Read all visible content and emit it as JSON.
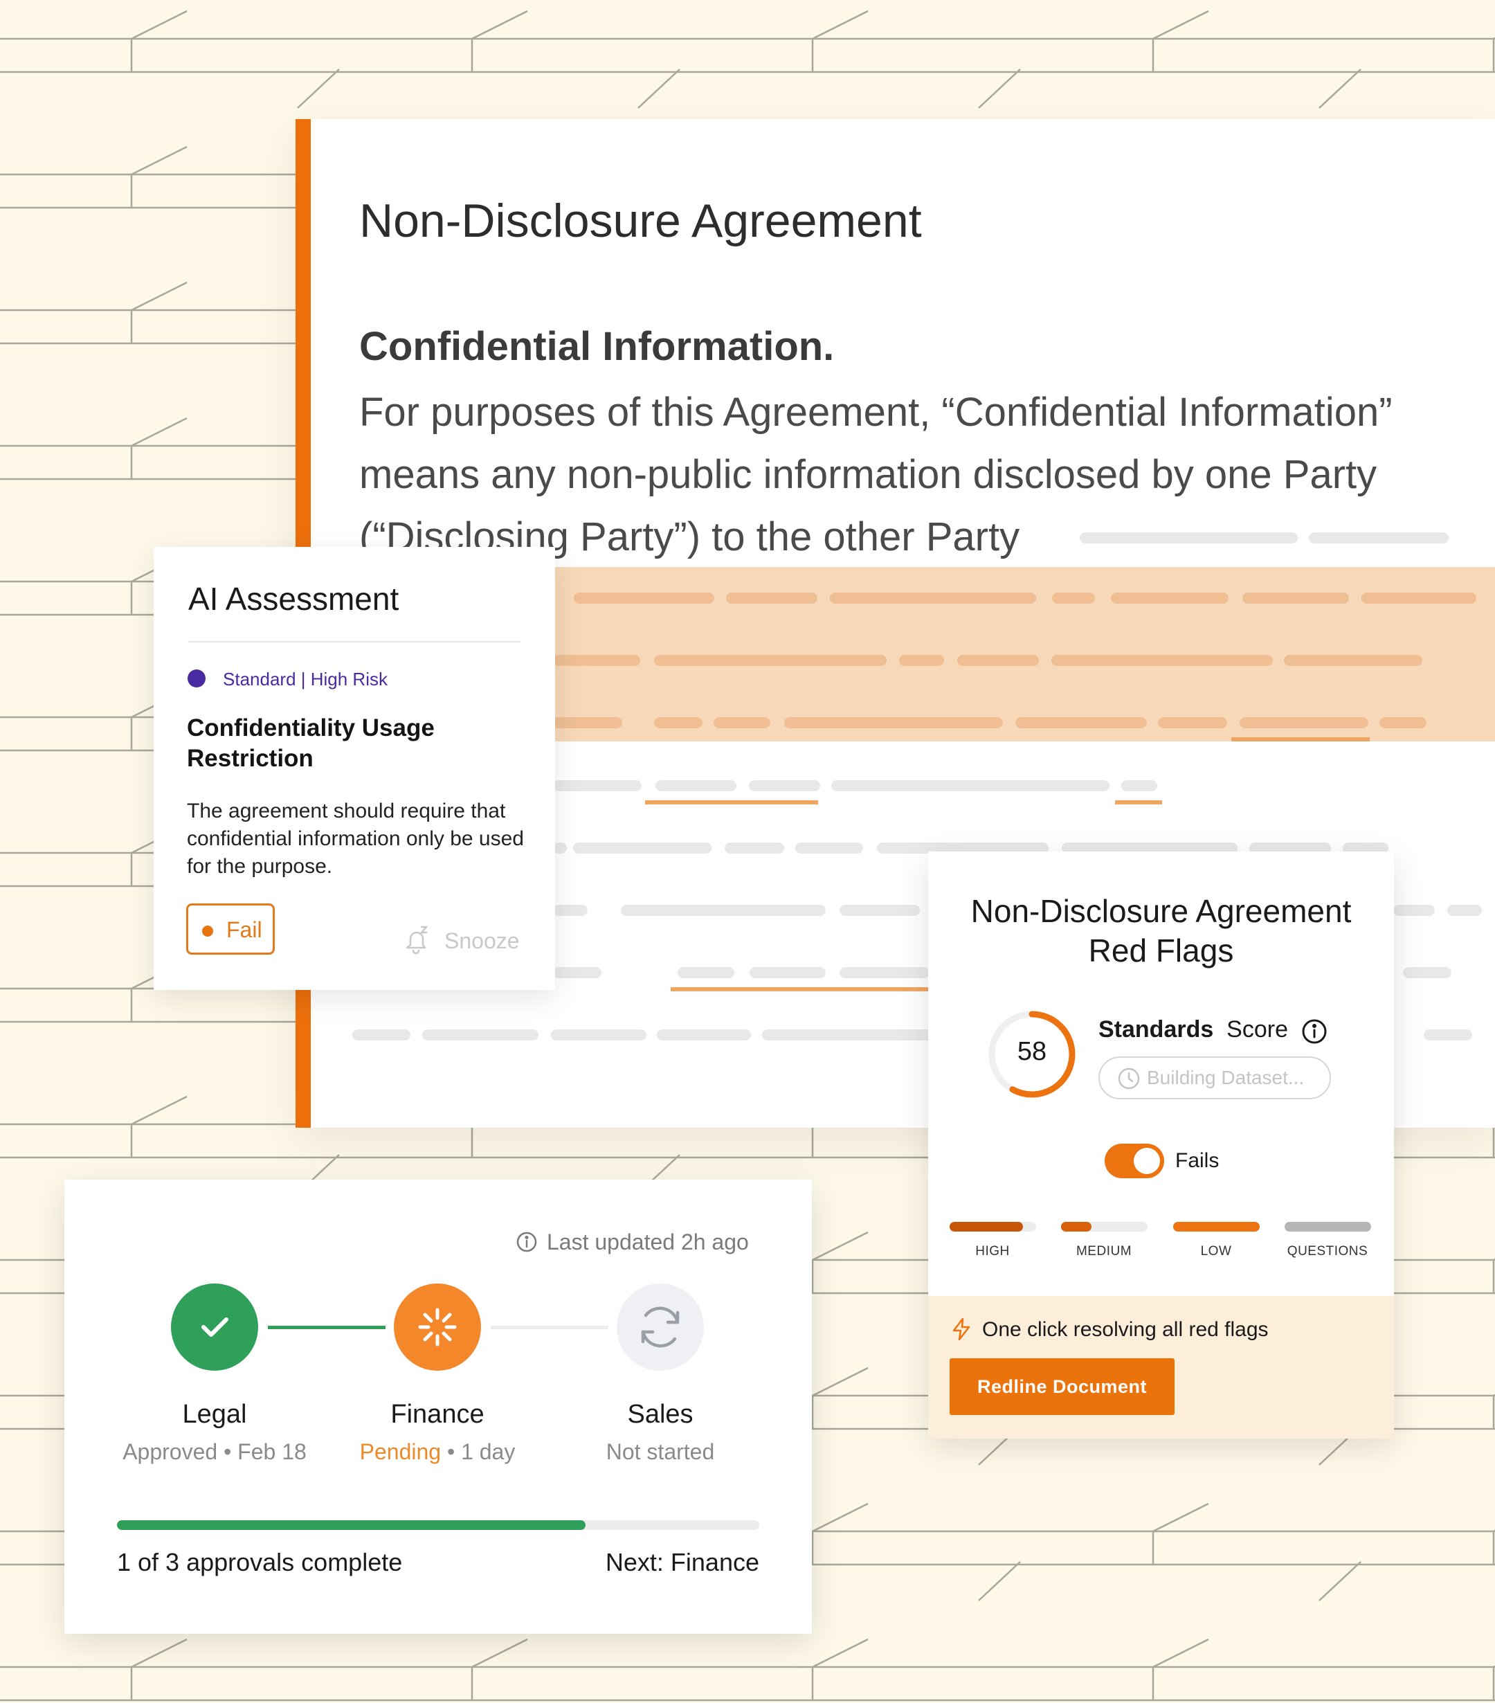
{
  "colors": {
    "background": "#fdf8e8",
    "accent_orange": "#ec6f0c",
    "highlight": "#f7d8b8",
    "risk_purple": "#4a2aa0",
    "success_green": "#2ea05a"
  },
  "document": {
    "title": "Non-Disclosure Agreement",
    "section_heading": "Confidential Information.",
    "body_lines": [
      "For purposes of this Agreement, “Confidential Information”",
      "means any non-public information disclosed by one Party",
      "(“Disclosing Party”) to the other Party"
    ]
  },
  "ai_assessment": {
    "title": "AI Assessment",
    "badge": "Standard | High Risk",
    "rule_title": "Confidentiality Usage Restriction",
    "description": "The agreement should require that confidential information only be used for the purpose.",
    "status_label": "Fail",
    "snooze_label": "Snooze",
    "snooze_icon": "bell-snooze-icon"
  },
  "red_flags": {
    "title_line1": "Non-Disclosure Agreement",
    "title_line2": "Red Flags",
    "score": "58",
    "score_fraction": 0.58,
    "standards_label": "Standards",
    "score_label": "Score",
    "info_icon": "info-icon",
    "dataset_status": "Building Dataset...",
    "toggle_label": "Fails",
    "toggle_on": true,
    "categories": [
      {
        "label": "HIGH",
        "fill": 0.85,
        "color": "#c8560a"
      },
      {
        "label": "MEDIUM",
        "fill": 0.35,
        "color": "#d9600b"
      },
      {
        "label": "LOW",
        "fill": 1.0,
        "color": "#ec730f"
      },
      {
        "label": "QUESTIONS",
        "fill": 1.0,
        "color": "#b5b5b5"
      }
    ],
    "footer_text": "One click resolving all red flags",
    "footer_icon": "lightning-icon",
    "action_label": "Redline Document"
  },
  "approvals": {
    "last_updated": "Last updated 2h ago",
    "steps": [
      {
        "name": "Legal",
        "status": "Approved",
        "detail": " • Feb 18",
        "state": "done",
        "icon": "check-icon"
      },
      {
        "name": "Finance",
        "status": "Pending",
        "detail": " • 1 day",
        "state": "pending",
        "icon": "spinner-icon"
      },
      {
        "name": "Sales",
        "status": "Not started",
        "detail": "",
        "state": "todo",
        "icon": "refresh-icon"
      }
    ],
    "progress_fraction": 0.73,
    "progress_text": "1 of 3 approvals complete",
    "next_text": "Next: Finance"
  }
}
